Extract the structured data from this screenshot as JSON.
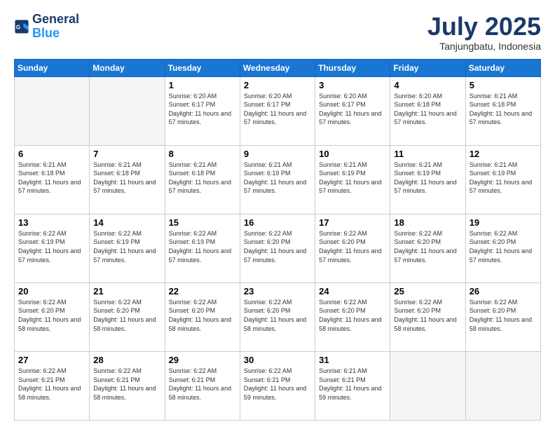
{
  "header": {
    "logo_line1": "General",
    "logo_line2": "Blue",
    "month": "July 2025",
    "location": "Tanjungbatu, Indonesia"
  },
  "weekdays": [
    "Sunday",
    "Monday",
    "Tuesday",
    "Wednesday",
    "Thursday",
    "Friday",
    "Saturday"
  ],
  "weeks": [
    [
      {
        "day": "",
        "info": ""
      },
      {
        "day": "",
        "info": ""
      },
      {
        "day": "1",
        "info": "Sunrise: 6:20 AM\nSunset: 6:17 PM\nDaylight: 11 hours and 57 minutes."
      },
      {
        "day": "2",
        "info": "Sunrise: 6:20 AM\nSunset: 6:17 PM\nDaylight: 11 hours and 57 minutes."
      },
      {
        "day": "3",
        "info": "Sunrise: 6:20 AM\nSunset: 6:17 PM\nDaylight: 11 hours and 57 minutes."
      },
      {
        "day": "4",
        "info": "Sunrise: 6:20 AM\nSunset: 6:18 PM\nDaylight: 11 hours and 57 minutes."
      },
      {
        "day": "5",
        "info": "Sunrise: 6:21 AM\nSunset: 6:18 PM\nDaylight: 11 hours and 57 minutes."
      }
    ],
    [
      {
        "day": "6",
        "info": "Sunrise: 6:21 AM\nSunset: 6:18 PM\nDaylight: 11 hours and 57 minutes."
      },
      {
        "day": "7",
        "info": "Sunrise: 6:21 AM\nSunset: 6:18 PM\nDaylight: 11 hours and 57 minutes."
      },
      {
        "day": "8",
        "info": "Sunrise: 6:21 AM\nSunset: 6:18 PM\nDaylight: 11 hours and 57 minutes."
      },
      {
        "day": "9",
        "info": "Sunrise: 6:21 AM\nSunset: 6:19 PM\nDaylight: 11 hours and 57 minutes."
      },
      {
        "day": "10",
        "info": "Sunrise: 6:21 AM\nSunset: 6:19 PM\nDaylight: 11 hours and 57 minutes."
      },
      {
        "day": "11",
        "info": "Sunrise: 6:21 AM\nSunset: 6:19 PM\nDaylight: 11 hours and 57 minutes."
      },
      {
        "day": "12",
        "info": "Sunrise: 6:21 AM\nSunset: 6:19 PM\nDaylight: 11 hours and 57 minutes."
      }
    ],
    [
      {
        "day": "13",
        "info": "Sunrise: 6:22 AM\nSunset: 6:19 PM\nDaylight: 11 hours and 57 minutes."
      },
      {
        "day": "14",
        "info": "Sunrise: 6:22 AM\nSunset: 6:19 PM\nDaylight: 11 hours and 57 minutes."
      },
      {
        "day": "15",
        "info": "Sunrise: 6:22 AM\nSunset: 6:19 PM\nDaylight: 11 hours and 57 minutes."
      },
      {
        "day": "16",
        "info": "Sunrise: 6:22 AM\nSunset: 6:20 PM\nDaylight: 11 hours and 57 minutes."
      },
      {
        "day": "17",
        "info": "Sunrise: 6:22 AM\nSunset: 6:20 PM\nDaylight: 11 hours and 57 minutes."
      },
      {
        "day": "18",
        "info": "Sunrise: 6:22 AM\nSunset: 6:20 PM\nDaylight: 11 hours and 57 minutes."
      },
      {
        "day": "19",
        "info": "Sunrise: 6:22 AM\nSunset: 6:20 PM\nDaylight: 11 hours and 57 minutes."
      }
    ],
    [
      {
        "day": "20",
        "info": "Sunrise: 6:22 AM\nSunset: 6:20 PM\nDaylight: 11 hours and 58 minutes."
      },
      {
        "day": "21",
        "info": "Sunrise: 6:22 AM\nSunset: 6:20 PM\nDaylight: 11 hours and 58 minutes."
      },
      {
        "day": "22",
        "info": "Sunrise: 6:22 AM\nSunset: 6:20 PM\nDaylight: 11 hours and 58 minutes."
      },
      {
        "day": "23",
        "info": "Sunrise: 6:22 AM\nSunset: 6:20 PM\nDaylight: 11 hours and 58 minutes."
      },
      {
        "day": "24",
        "info": "Sunrise: 6:22 AM\nSunset: 6:20 PM\nDaylight: 11 hours and 58 minutes."
      },
      {
        "day": "25",
        "info": "Sunrise: 6:22 AM\nSunset: 6:20 PM\nDaylight: 11 hours and 58 minutes."
      },
      {
        "day": "26",
        "info": "Sunrise: 6:22 AM\nSunset: 6:20 PM\nDaylight: 11 hours and 58 minutes."
      }
    ],
    [
      {
        "day": "27",
        "info": "Sunrise: 6:22 AM\nSunset: 6:21 PM\nDaylight: 11 hours and 58 minutes."
      },
      {
        "day": "28",
        "info": "Sunrise: 6:22 AM\nSunset: 6:21 PM\nDaylight: 11 hours and 58 minutes."
      },
      {
        "day": "29",
        "info": "Sunrise: 6:22 AM\nSunset: 6:21 PM\nDaylight: 11 hours and 58 minutes."
      },
      {
        "day": "30",
        "info": "Sunrise: 6:22 AM\nSunset: 6:21 PM\nDaylight: 11 hours and 59 minutes."
      },
      {
        "day": "31",
        "info": "Sunrise: 6:21 AM\nSunset: 6:21 PM\nDaylight: 11 hours and 59 minutes."
      },
      {
        "day": "",
        "info": ""
      },
      {
        "day": "",
        "info": ""
      }
    ]
  ]
}
